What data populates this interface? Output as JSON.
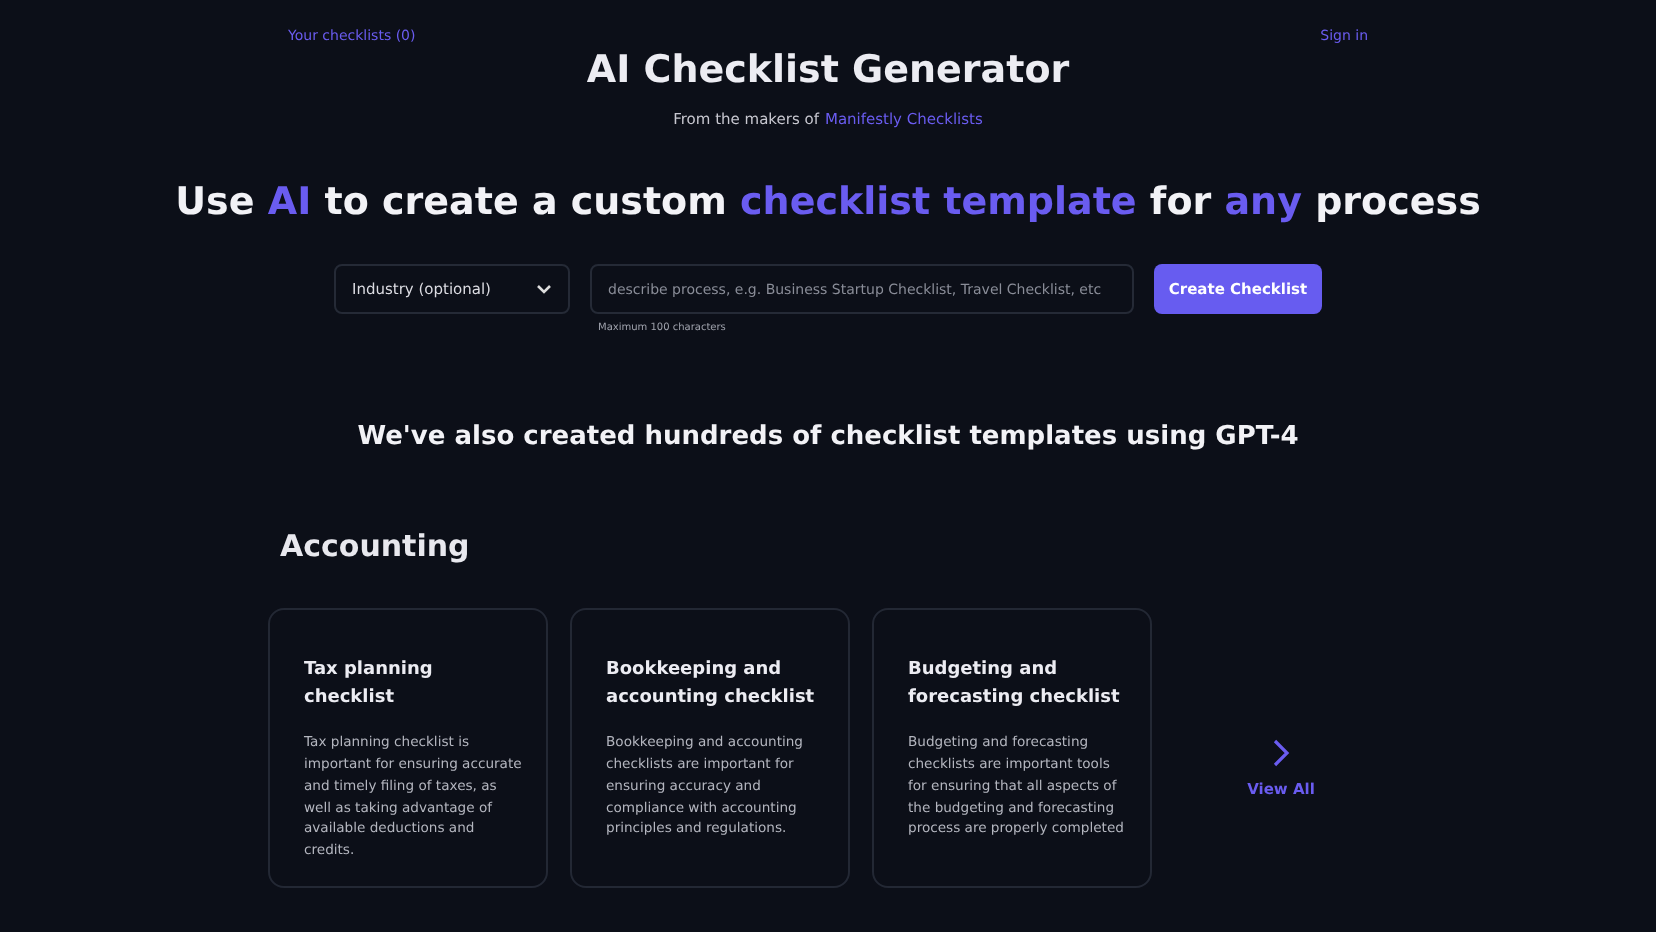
{
  "nav": {
    "checklists_link": "Your checklists (0)",
    "sign_in": "Sign in"
  },
  "title": "AI Checklist Generator",
  "subtitle": {
    "text": "From the makers of",
    "link": "Manifestly Checklists"
  },
  "headline": [
    {
      "text": "Use ",
      "highlight": false
    },
    {
      "text": "AI",
      "highlight": true
    },
    {
      "text": " to create a custom ",
      "highlight": false
    },
    {
      "text": "checklist template",
      "highlight": true
    },
    {
      "text": " for ",
      "highlight": false
    },
    {
      "text": "any",
      "highlight": true
    },
    {
      "text": " process",
      "highlight": false
    }
  ],
  "form": {
    "industry_select": "Industry (optional)",
    "process_field": {
      "placeholder": "describe process, e.g. Business Startup Checklist, Travel Checklist, etc"
    },
    "hint": "Maximum 100 characters",
    "button": "Create Checklist"
  },
  "templates_heading": "We've also created hundreds of checklist templates using GPT-4",
  "category": {
    "title": "Accounting",
    "cards": [
      {
        "title": "Tax planning checklist",
        "description": "Tax planning checklist is important for ensuring accurate and timely filing of taxes, as well as taking advantage of available deductions and credits."
      },
      {
        "title": "Bookkeeping and accounting checklist",
        "description": "Bookkeeping and accounting checklists are important for ensuring accuracy and compliance with accounting principles and regulations."
      },
      {
        "title": "Budgeting and forecasting checklist",
        "description": "Budgeting and forecasting checklists are important tools for ensuring that all aspects of the budgeting and forecasting process are properly completed"
      }
    ],
    "view_all": "View All"
  }
}
